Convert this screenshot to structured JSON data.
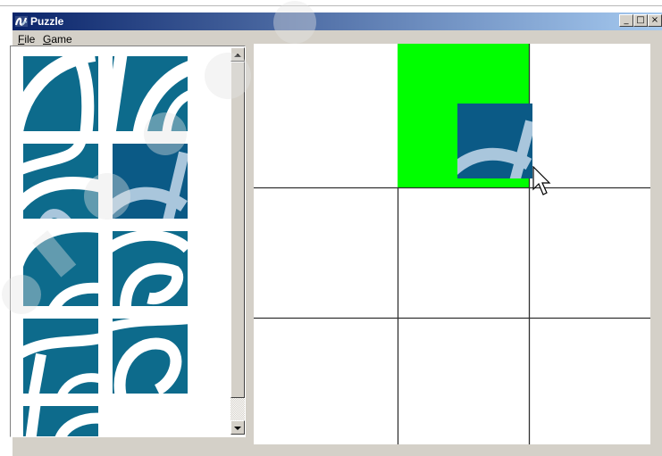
{
  "window": {
    "title": "Puzzle",
    "controls": {
      "minimize": "_",
      "maximize": "□",
      "close": "×"
    }
  },
  "menu": [
    {
      "label": "File",
      "accel": "F",
      "rest": "ile"
    },
    {
      "label": "Game",
      "accel": "G",
      "rest": "ame"
    }
  ],
  "colors": {
    "tile_blue": "#0d6b8c",
    "tile_blue_dark": "#0b5a86",
    "tile_light": "#a9c6dc",
    "highlight_green": "#00ff00",
    "grid_line": "#303030"
  },
  "tray": {
    "tiles": [
      {
        "id": "piece-1",
        "shape": "arc-left"
      },
      {
        "id": "piece-2",
        "shape": "ribbon-top"
      },
      {
        "id": "piece-3",
        "shape": "hook"
      },
      {
        "id": "piece-4",
        "shape": "dark-with-light-stripe"
      },
      {
        "id": "piece-5",
        "shape": "round-left"
      },
      {
        "id": "piece-6",
        "shape": "swirl"
      },
      {
        "id": "piece-7",
        "shape": "loop-left"
      },
      {
        "id": "piece-8",
        "shape": "loop-right"
      },
      {
        "id": "piece-9",
        "shape": "fragment"
      }
    ]
  },
  "board": {
    "rows": 3,
    "cols": 3,
    "highlighted_cell": "row-1-col-2"
  },
  "drag": {
    "piece": "dark-with-light-stripe"
  },
  "icons": {
    "app": "puzzle-app-icon",
    "scroll_up": "up-arrow-icon",
    "scroll_down": "down-arrow-icon",
    "cursor": "mouse-pointer-icon"
  }
}
